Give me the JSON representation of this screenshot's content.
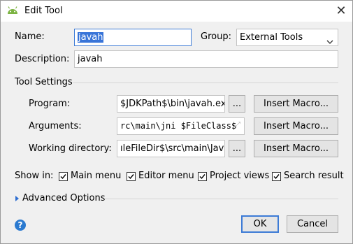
{
  "window": {
    "title": "Edit Tool"
  },
  "form": {
    "name_label": "Name:",
    "name_value": "javah",
    "group_label": "Group:",
    "group_value": "External Tools",
    "description_label": "Description:",
    "description_value": "javah"
  },
  "tool_settings": {
    "section_title": "Tool Settings",
    "program_label": "Program:",
    "program_value": "$JDKPath$\\bin\\javah.exe",
    "arguments_label": "Arguments:",
    "arguments_value": "rc\\main\\jni $FileClass$",
    "workdir_label": "Working directory:",
    "workdir_value": "ıleFileDir$\\src\\main\\Java",
    "browse_label": "...",
    "insert_macro_label": "Insert Macro..."
  },
  "show_in": {
    "label": "Show in:",
    "options": [
      {
        "label": "Main menu",
        "checked": true
      },
      {
        "label": "Editor menu",
        "checked": true
      },
      {
        "label": "Project views",
        "checked": true
      },
      {
        "label": "Search result",
        "checked": true
      }
    ]
  },
  "advanced": {
    "label": "Advanced Options"
  },
  "footer": {
    "help": "?",
    "ok": "OK",
    "cancel": "Cancel"
  },
  "colors": {
    "accent": "#3d7bd6",
    "android_green": "#7cb342",
    "help_blue": "#2b7ad0"
  }
}
